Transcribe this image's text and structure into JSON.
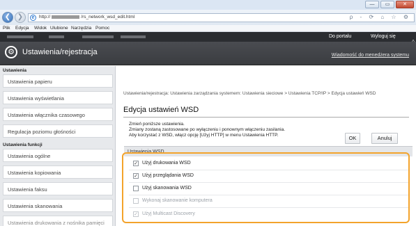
{
  "browser": {
    "url_start": "http://",
    "url_end": "/rs_network_wsd_edit.html",
    "menu": [
      "Plik",
      "Edycja",
      "Widok",
      "Ulubione",
      "Narzędzia",
      "Pomoc"
    ],
    "tools": "ρ - ⟳  ⌂ ☆ ⚙",
    "win_controls": [
      "—",
      "▭",
      "✕"
    ]
  },
  "header": {
    "portal_link": "Do portalu",
    "logout_link": "Wyloguj się",
    "title": "Ustawienia/rejestracja",
    "message_link": "Wiadomość do menedżera systemu"
  },
  "sidebar": {
    "section1_title": "Ustawienia",
    "items1": [
      "Ustawienia papieru",
      "Ustawienia wyświetlania",
      "Ustawienia włącznika czasowego",
      "Regulacja poziomu głośności"
    ],
    "section2_title": "Ustawienia funkcji",
    "items2": [
      "Ustawienia ogólne",
      "Ustawienia kopiowania",
      "Ustawienia faksu",
      "Ustawienia skanowania",
      "Ustawienia drukowania z nośnika pamięci"
    ]
  },
  "main": {
    "breadcrumb": "Ustawienia/rejestracja: Ustawienia zarządzania systemem: Ustawienia sieciowe > Ustawienia TCP/IP > Edycja ustawień WSD",
    "page_title": "Edycja ustawień WSD",
    "desc_lines": [
      "Zmień poniższe ustawienia.",
      "Zmiany zostaną zastosowane po wyłączeniu i ponownym włączeniu zasilania.",
      "Aby korzystać z WSD, włącz opcję [Użyj HTTP] w menu Ustawienia HTTP."
    ],
    "ok_label": "OK",
    "cancel_label": "Anuluj",
    "group_title": "Ustawienia WSD",
    "options": [
      {
        "label": "Użyj drukowania WSD",
        "checked": true,
        "disabled": false
      },
      {
        "label": "Użyj przeglądania WSD",
        "checked": true,
        "disabled": false
      },
      {
        "label": "Użyj skanowania WSD",
        "checked": false,
        "disabled": false
      },
      {
        "label": "Wykonaj skanowanie komputera",
        "checked": false,
        "disabled": true
      },
      {
        "label": "Użyj Multicast Discovery",
        "checked": true,
        "disabled": true
      }
    ]
  },
  "colors": {
    "highlight": "#f3a32b",
    "header_dark": "#2b2d31",
    "sidebar_bg": "#e7e9ec"
  }
}
